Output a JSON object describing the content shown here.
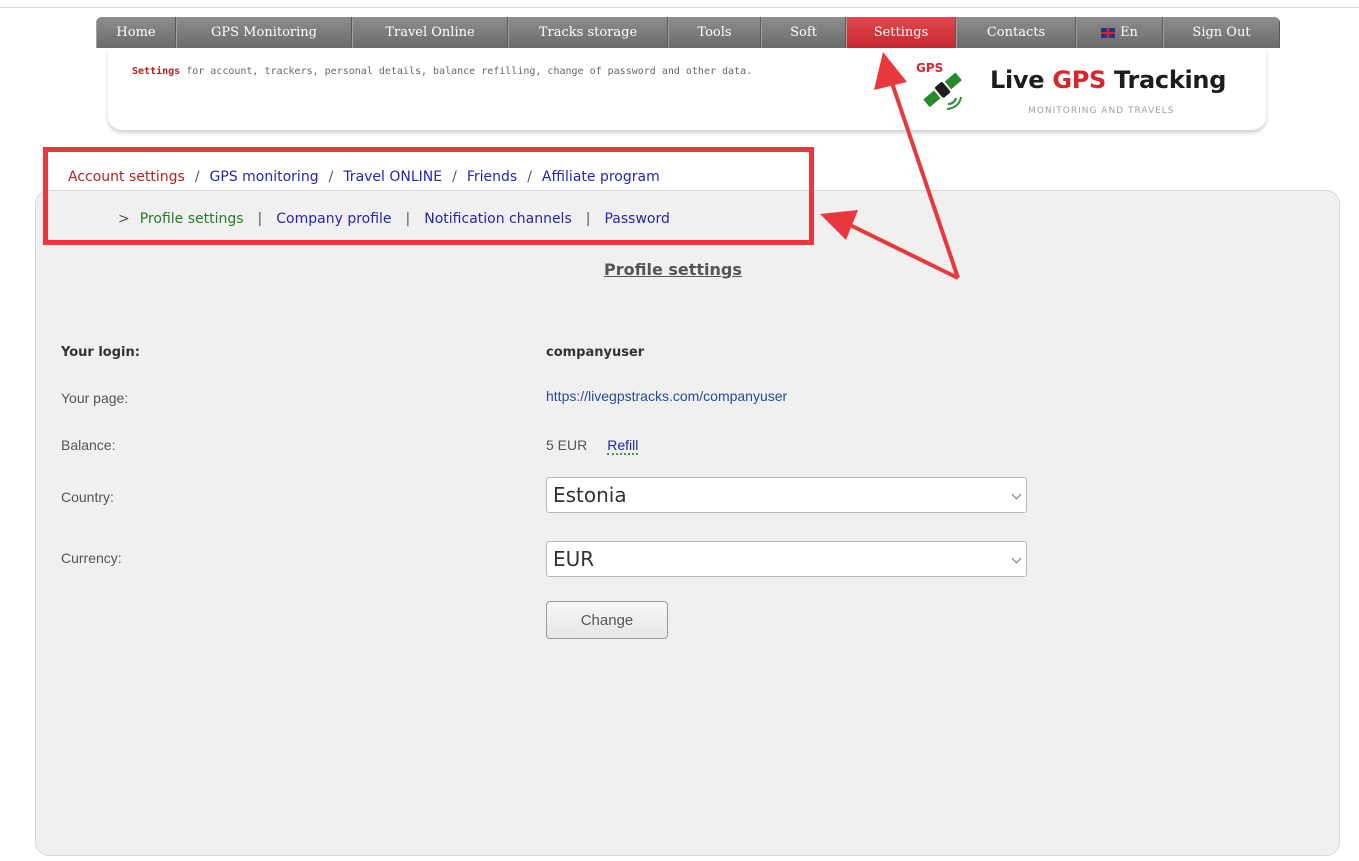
{
  "nav": {
    "items": [
      {
        "label": "Home"
      },
      {
        "label": "GPS Monitoring"
      },
      {
        "label": "Travel Online"
      },
      {
        "label": "Tracks storage"
      },
      {
        "label": "Tools"
      },
      {
        "label": "Soft"
      },
      {
        "label": "Settings",
        "active": true
      },
      {
        "label": "Contacts"
      },
      {
        "label": "En",
        "icon": "uk-flag-icon"
      },
      {
        "label": "Sign Out"
      }
    ]
  },
  "header": {
    "desc_bold": "Settings",
    "desc_rest": " for account, trackers, personal details, balance refilling, change of password and other data.",
    "logo_gps_badge": "GPS",
    "logo_title_1": "Live ",
    "logo_title_2": "GPS",
    "logo_title_3": " Tracking",
    "logo_sub": "MONITORING AND TRAVELS"
  },
  "breadcrumbs": {
    "level1": [
      "Account settings",
      "GPS monitoring",
      "Travel ONLINE",
      "Friends",
      "Affiliate program"
    ],
    "sep1": "/",
    "marker": ">",
    "level2": [
      "Profile settings",
      "Company profile",
      "Notification channels",
      "Password"
    ],
    "sep2": "|"
  },
  "profile": {
    "title": "Profile settings",
    "login_label": "Your login:",
    "login_value": "companyuser",
    "page_label": "Your page:",
    "page_value": "https://livegpstracks.com/companyuser",
    "balance_label": "Balance:",
    "balance_value": "5 EUR",
    "refill_label": "Refill",
    "country_label": "Country:",
    "country_value": "Estonia",
    "currency_label": "Currency:",
    "currency_value": "EUR",
    "change_label": "Change"
  },
  "colors": {
    "accent": "#d7262e",
    "annotation": "#e8383d",
    "link": "#2626b0",
    "current_green": "#2a7a2a"
  }
}
